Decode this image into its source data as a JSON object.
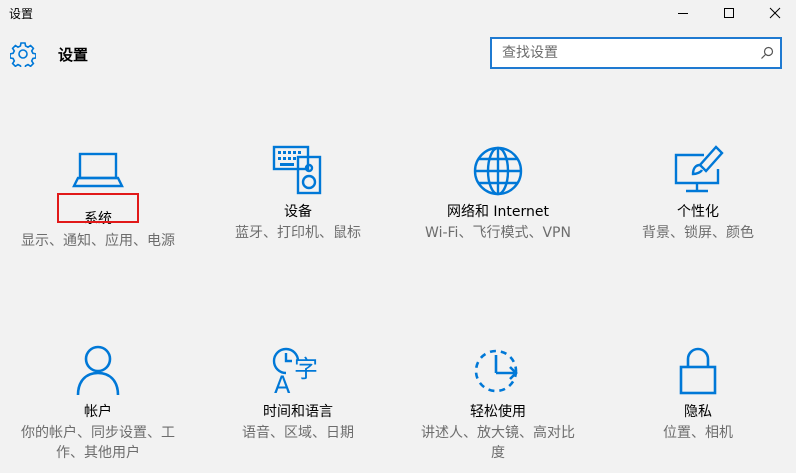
{
  "window": {
    "title": "设置"
  },
  "header": {
    "title": "设置"
  },
  "search": {
    "placeholder": "查找设置"
  },
  "tiles": [
    {
      "name": "系统",
      "desc": "显示、通知、应用、电源",
      "icon": "laptop-icon"
    },
    {
      "name": "设备",
      "desc": "蓝牙、打印机、鼠标",
      "icon": "keyboard-speaker-icon"
    },
    {
      "name": "网络和 Internet",
      "desc": "Wi-Fi、飞行模式、VPN",
      "icon": "globe-icon"
    },
    {
      "name": "个性化",
      "desc": "背景、锁屏、颜色",
      "icon": "paint-monitor-icon"
    },
    {
      "name": "帐户",
      "desc": "你的帐户、同步设置、工作、其他用户",
      "icon": "person-icon"
    },
    {
      "name": "时间和语言",
      "desc": "语音、区域、日期",
      "icon": "time-language-icon"
    },
    {
      "name": "轻松使用",
      "desc": "讲述人、放大镜、高对比度",
      "icon": "ease-of-access-icon"
    },
    {
      "name": "隐私",
      "desc": "位置、相机",
      "icon": "lock-icon"
    }
  ],
  "colors": {
    "accent": "#0078d7",
    "highlight": "#e11919",
    "background": "#f2f2f2"
  }
}
